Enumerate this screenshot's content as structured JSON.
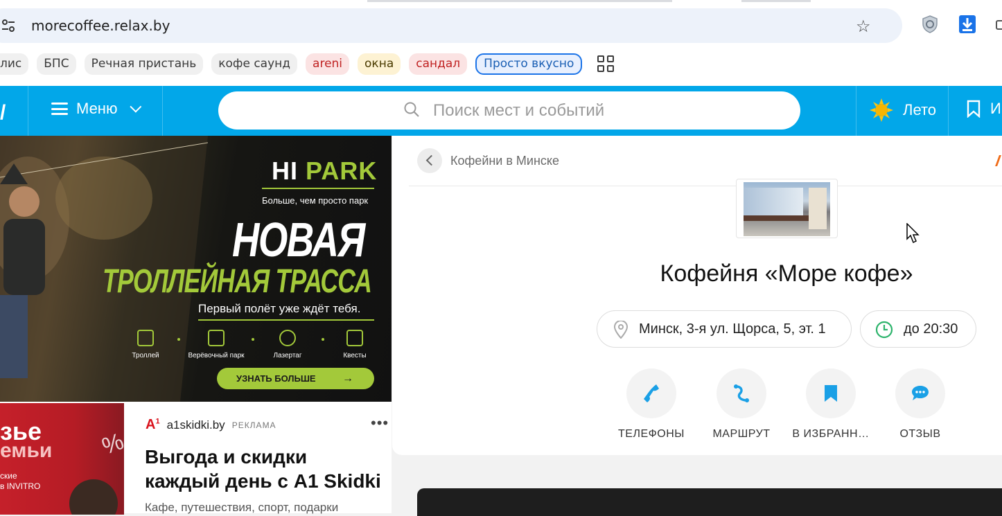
{
  "browser": {
    "url": "morecoffee.relax.by",
    "bookmarks": [
      {
        "label": "лис",
        "style": "first"
      },
      {
        "label": "БПС",
        "style": "plain"
      },
      {
        "label": "Речная пристань",
        "style": "plain"
      },
      {
        "label": "кофе саунд",
        "style": "plain"
      },
      {
        "label": "areni",
        "style": "red"
      },
      {
        "label": "окна",
        "style": "yel"
      },
      {
        "label": "сандал",
        "style": "red"
      },
      {
        "label": "Просто вкусно",
        "style": "blue"
      }
    ]
  },
  "header": {
    "menu_label": "Меню",
    "search_placeholder": "Поиск мест и событий",
    "season_label": "Лето",
    "favorites_label": "И"
  },
  "banner": {
    "brand_hi": "HI",
    "brand_park": "PARK",
    "tagline": "Больше, чем просто парк",
    "title1": "НОВАЯ",
    "title2": "ТРОЛЛЕЙНАЯ ТРАССА",
    "subtitle": "Первый полёт уже ждёт тебя.",
    "features": [
      "Троллей",
      "Верёвочный парк",
      "Лазертаг",
      "Квесты"
    ],
    "cta": "УЗНАТЬ БОЛЬШЕ"
  },
  "ad": {
    "image_line1": "зьe",
    "image_line2": "емьи",
    "image_line3": "ские\nв INVITRO",
    "domain": "a1skidki.by",
    "label": "РЕКЛАМА",
    "title": "Выгода и скидки каждый день с A1 Skidki",
    "text": "Кафе, путешествия, спорт, подарки"
  },
  "place": {
    "breadcrumb": "Кофейни в Минске",
    "title": "Кофейня «Море кофе»",
    "address": "Минск, 3-я ул. Щорса, 5, эт. 1",
    "hours": "до 20:30",
    "actions": [
      {
        "label": "ТЕЛЕФОНЫ",
        "icon": "phone-icon"
      },
      {
        "label": "МАРШРУТ",
        "icon": "route-icon"
      },
      {
        "label": "В ИЗБРАНН…",
        "icon": "bookmark-icon"
      },
      {
        "label": "ОТЗЫВ",
        "icon": "comment-icon"
      }
    ]
  },
  "colors": {
    "brand_blue": "#02a7e9",
    "park_green": "#a3c93a",
    "accent_orange": "#ef6c1a",
    "action_blue": "#1aa0e6"
  }
}
